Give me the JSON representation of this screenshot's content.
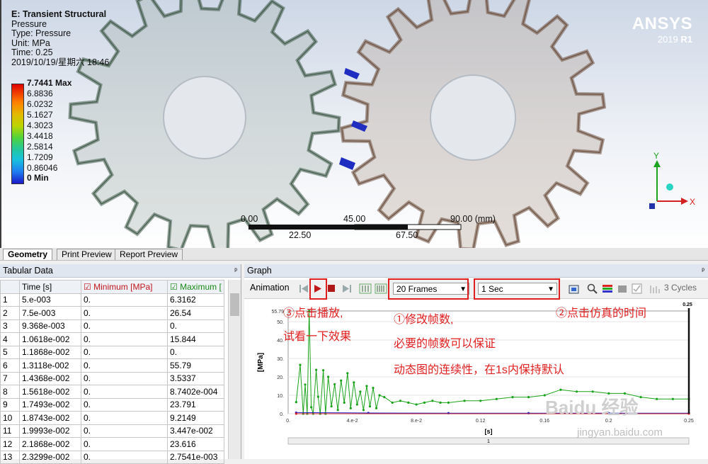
{
  "viewport": {
    "analysis_title": "E: Transient Structural",
    "result_name": "Pressure",
    "type_line": "Type: Pressure",
    "unit_line": "Unit: MPa",
    "time_line": "Time: 0.25",
    "date_line": "2019/10/19/星期六 18:46",
    "legend": [
      "7.7441 Max",
      "6.8836",
      "6.0232",
      "5.1627",
      "4.3023",
      "3.4418",
      "2.5814",
      "1.7209",
      "0.86046",
      "0 Min"
    ],
    "logo": {
      "name": "ANSYS",
      "version_year": "2019",
      "version_rev": "R1"
    },
    "ruler": {
      "top_labels": [
        "0.00",
        "45.00",
        "90.00 (mm)"
      ],
      "bottom_labels": [
        "22.50",
        "67.50"
      ]
    },
    "triad": {
      "y": "Y",
      "x": "X"
    },
    "colors": {
      "left_gear": "#a9b5b0",
      "right_gear": "#b8a99c"
    }
  },
  "view_tabs": [
    "Geometry",
    "Print Preview",
    "Report Preview"
  ],
  "tabular": {
    "title": "Tabular Data",
    "pin": "ᵖ",
    "columns": [
      "Time [s]",
      "Minimum [MPa]",
      "Maximum ["
    ],
    "rows": [
      [
        "1",
        "5.e-003",
        "0.",
        "6.3162"
      ],
      [
        "2",
        "7.5e-003",
        "0.",
        "26.54"
      ],
      [
        "3",
        "9.368e-003",
        "0.",
        "0."
      ],
      [
        "4",
        "1.0618e-002",
        "0.",
        "15.844"
      ],
      [
        "5",
        "1.1868e-002",
        "0.",
        "0."
      ],
      [
        "6",
        "1.3118e-002",
        "0.",
        "55.79"
      ],
      [
        "7",
        "1.4368e-002",
        "0.",
        "3.5337"
      ],
      [
        "8",
        "1.5618e-002",
        "0.",
        "8.7402e-004"
      ],
      [
        "9",
        "1.7493e-002",
        "0.",
        "23.791"
      ],
      [
        "10",
        "1.8743e-002",
        "0.",
        "9.2149"
      ],
      [
        "11",
        "1.9993e-002",
        "0.",
        "3.447e-002"
      ],
      [
        "12",
        "2.1868e-002",
        "0.",
        "23.616"
      ],
      [
        "13",
        "2.3299e-002",
        "0.",
        "2.7541e-003"
      ]
    ]
  },
  "graph": {
    "title": "Graph",
    "pin": "ᵖ",
    "animation_label": "Animation",
    "frames_value": "20 Frames",
    "duration_value": "1 Sec",
    "cycles_label": "3 Cycles"
  },
  "annotations": {
    "play_1": "③点击播放,",
    "play_2": "试看一下效果",
    "frames_1": "①修改帧数,",
    "frames_2": "必要的帧数可以保证",
    "frames_3": "动态图的连续性，在1s内保持默认",
    "time": "②点击仿真的时间"
  },
  "watermark": {
    "line1": "Baidu 经验",
    "line2": "jingyan.baidu.com"
  },
  "chart_data": {
    "type": "line",
    "ylabel": "[MPa]",
    "xlabel": "[s]",
    "y_top_label": "55.79",
    "y_ticks": [
      "50.",
      "40.",
      "30.",
      "20.",
      "10.",
      "0."
    ],
    "x_ticks": [
      "0.",
      "4.e-2",
      "8.e-2",
      "0.12",
      "0.16",
      "0.2",
      "0.25"
    ],
    "cursor_label": "0.25",
    "scrub_label": "1",
    "ylim": [
      0,
      55.79
    ],
    "xlim": [
      0,
      0.25
    ],
    "series": [
      {
        "color": "#1aa31a",
        "x": [
          0.005,
          0.0075,
          0.0094,
          0.0106,
          0.0119,
          0.0131,
          0.0144,
          0.0156,
          0.0175,
          0.0187,
          0.02,
          0.0219,
          0.0233,
          0.025,
          0.027,
          0.029,
          0.031,
          0.033,
          0.035,
          0.037,
          0.039,
          0.041,
          0.043,
          0.045,
          0.047,
          0.049,
          0.051,
          0.053,
          0.055,
          0.057,
          0.06,
          0.065,
          0.07,
          0.075,
          0.08,
          0.085,
          0.09,
          0.095,
          0.1,
          0.11,
          0.12,
          0.13,
          0.14,
          0.15,
          0.16,
          0.17,
          0.18,
          0.19,
          0.2,
          0.21,
          0.22,
          0.23,
          0.24,
          0.25
        ],
        "values": [
          6.3,
          26.5,
          0,
          15.8,
          0,
          55.8,
          3.5,
          0,
          23.8,
          9.2,
          0,
          23.6,
          0,
          20,
          4,
          16,
          2,
          18,
          6,
          22,
          3,
          17,
          5,
          12,
          2,
          15,
          4,
          14,
          3,
          10,
          9,
          6,
          7,
          6,
          5,
          6,
          7,
          6,
          6,
          7,
          7,
          8,
          9,
          9,
          10,
          13,
          12,
          12,
          11,
          11,
          9,
          8,
          8,
          8
        ]
      },
      {
        "color": "#2424c8",
        "x": [
          0.005,
          0.05,
          0.1,
          0.15,
          0.2,
          0.25
        ],
        "values": [
          0.6,
          0.4,
          0.3,
          0.3,
          0.3,
          0.3
        ]
      },
      {
        "color": "#d02020",
        "x": [
          0.005,
          0.25
        ],
        "values": [
          0,
          0
        ]
      }
    ]
  }
}
